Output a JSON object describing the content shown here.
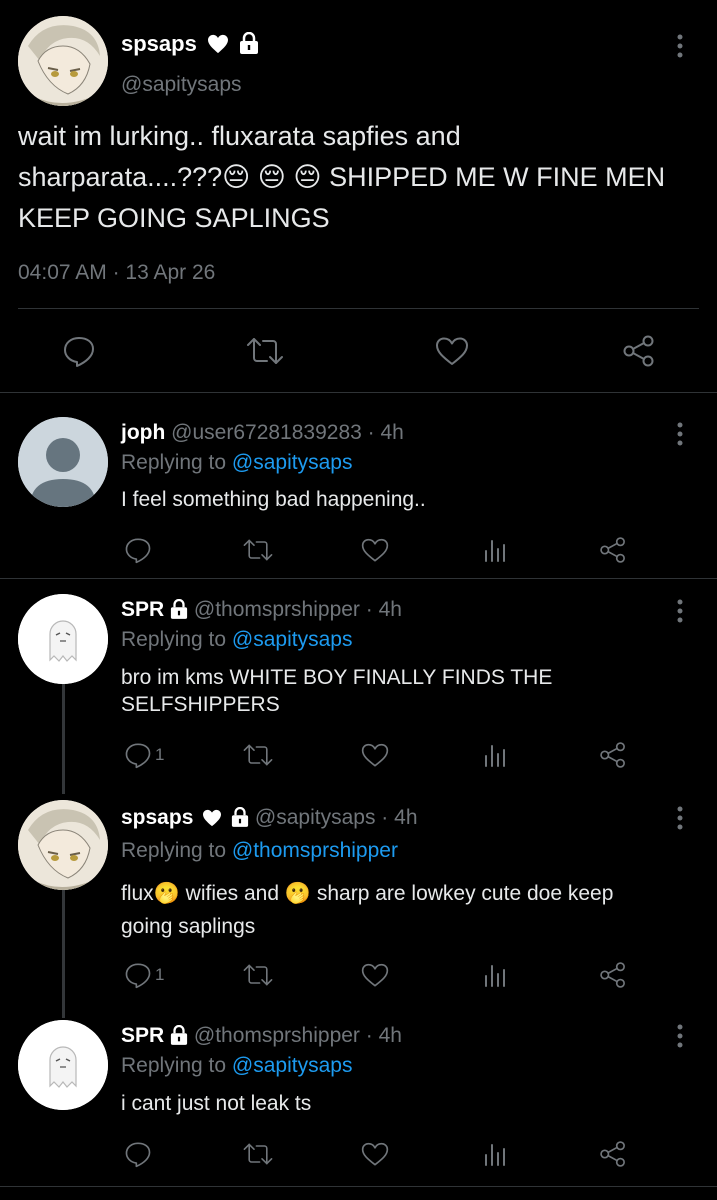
{
  "main_tweet": {
    "display_name": "spsaps",
    "handle": "@sapitysaps",
    "text_line1": "wait im lurking.. fluxarata sapfies and",
    "text_line2": "sharparata....???😔 😔 😔 SHIPPED ME W FINE MEN",
    "text_line3": "KEEP GOING SAPLINGS",
    "timestamp": "04:07 AM",
    "date": "13 Apr 26"
  },
  "replies": [
    {
      "display_name": "joph",
      "handle": "@user67281839283",
      "age": "4h",
      "replying_prefix": "Replying to",
      "replying_to": "@sapitysaps",
      "text_lines": [
        "I feel something bad happening.."
      ],
      "reply_count": ""
    },
    {
      "display_name": "SPR",
      "handle": "@thomsprshipper",
      "age": "4h",
      "replying_prefix": "Replying to",
      "replying_to": "@sapitysaps",
      "text_lines": [
        "bro im kms WHITE BOY FINALLY FINDS THE",
        "SELFSHIPPERS"
      ],
      "reply_count": "1"
    },
    {
      "display_name": "spsaps",
      "handle": "@sapitysaps",
      "age": "4h",
      "replying_prefix": "Replying to",
      "replying_to": "@thomsprshipper",
      "text_lines": [
        "flux🫢 wifies and 🫢 sharp are lowkey cute doe keep",
        "going saplings"
      ],
      "reply_count": "1"
    },
    {
      "display_name": "SPR",
      "handle": "@thomsprshipper",
      "age": "4h",
      "replying_prefix": "Replying to",
      "replying_to": "@sapitysaps",
      "text_lines": [
        "i cant just not leak ts"
      ],
      "reply_count": ""
    }
  ],
  "icons": {
    "reply": "reply-icon",
    "retweet": "retweet-icon",
    "like": "heart-icon",
    "views": "views-icon",
    "share": "share-icon",
    "more": "more-icon",
    "lock": "lock-icon"
  },
  "colors": {
    "background": "#000000",
    "text": "#e7e9ea",
    "secondary": "#71767b",
    "link": "#1d9bf0",
    "divider": "#2f3336"
  }
}
